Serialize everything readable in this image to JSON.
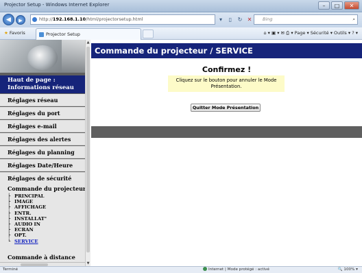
{
  "browser": {
    "window_title": "Projector Setup - Windows Internet Explorer",
    "address_prefix": "http://",
    "address_host": "192.168.1.10",
    "address_path": "/html/projectorsetup.html",
    "search_placeholder": "Bing",
    "favorites_label": "Favoris",
    "tab_label": "Projector Setup",
    "command_bar": "Page ▾  Sécurité ▾  Outils ▾",
    "status_left": "Terminé",
    "status_zone": "Internet | Mode protégé : activé",
    "zoom": "100%"
  },
  "sidebar": {
    "home_line1": "Haut de page :",
    "home_line2": "Informations réseau",
    "items": [
      {
        "label": "Réglages réseau"
      },
      {
        "label": "Réglages du port"
      },
      {
        "label": "Réglages e-mail"
      },
      {
        "label": "Réglages des alertes"
      },
      {
        "label": "Réglages du planning"
      },
      {
        "label": "Réglages Date/Heure"
      },
      {
        "label": "Réglages de sécurité"
      }
    ],
    "command_heading": "Commande du projecteur",
    "command_items": [
      {
        "label": "PRINCIPAL"
      },
      {
        "label": "IMAGE"
      },
      {
        "label": "AFFICHAGE"
      },
      {
        "label": "ENTR."
      },
      {
        "label": "INSTALLAT°"
      },
      {
        "label": "AUDIO IN"
      },
      {
        "label": "ECRAN"
      },
      {
        "label": "OPT."
      },
      {
        "label": "SERVICE"
      }
    ],
    "remote_heading": "Commande à distance"
  },
  "main": {
    "title": "Commande du projecteur / SERVICE",
    "confirm_heading": "Confirmez !",
    "message_line1": "Cliquez sur le bouton pour annuler le Mode",
    "message_line2": "Présentation.",
    "button_label": "Quitter Mode Présentation"
  },
  "colors": {
    "nav_blue": "#16247a",
    "message_bg": "#fdfbc8",
    "sidebar_gray": "#5f5f5f",
    "menu_bg": "#e6e6e6"
  }
}
